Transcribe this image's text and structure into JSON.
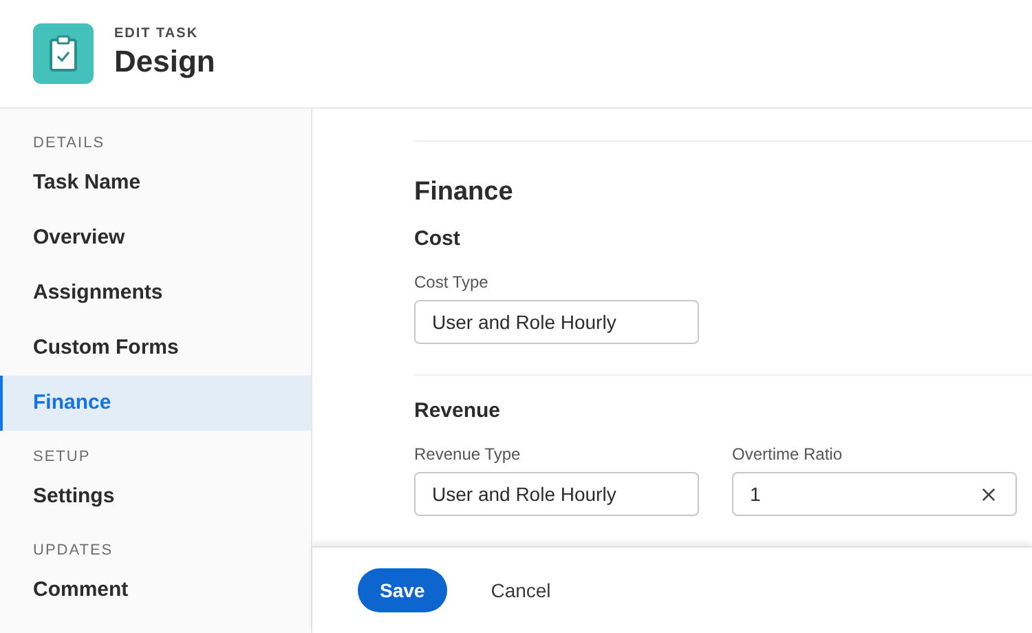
{
  "header": {
    "overline": "EDIT TASK",
    "title": "Design"
  },
  "sidebar": {
    "sections": [
      {
        "heading": "DETAILS",
        "items": [
          {
            "label": "Task Name",
            "selected": false
          },
          {
            "label": "Overview",
            "selected": false
          },
          {
            "label": "Assignments",
            "selected": false
          },
          {
            "label": "Custom Forms",
            "selected": false
          },
          {
            "label": "Finance",
            "selected": true
          }
        ]
      },
      {
        "heading": "SETUP",
        "items": [
          {
            "label": "Settings",
            "selected": false
          }
        ]
      },
      {
        "heading": "UPDATES",
        "items": [
          {
            "label": "Comment",
            "selected": false
          }
        ]
      }
    ]
  },
  "main": {
    "section_title": "Finance",
    "groups": [
      {
        "title": "Cost",
        "fields": [
          {
            "label": "Cost Type",
            "value": "User and Role Hourly",
            "clearable": false
          }
        ]
      },
      {
        "title": "Revenue",
        "fields": [
          {
            "label": "Revenue Type",
            "value": "User and Role Hourly",
            "clearable": false
          },
          {
            "label": "Overtime Ratio",
            "value": "1",
            "clearable": true
          }
        ]
      }
    ]
  },
  "footer": {
    "buttons": [
      {
        "label": "Save",
        "kind": "primary"
      },
      {
        "label": "Cancel",
        "kind": "secondary"
      }
    ]
  }
}
